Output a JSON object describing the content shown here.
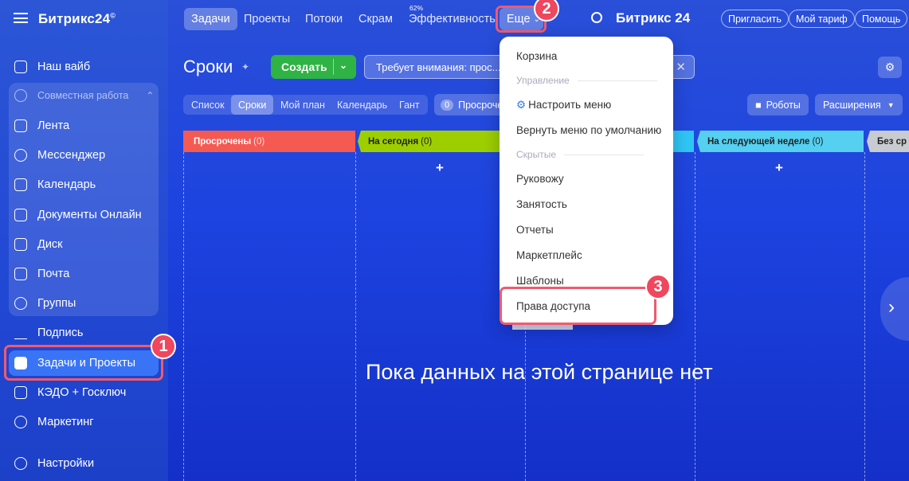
{
  "sidebar": {
    "brand": "Битрикс24",
    "brand_mark": "©",
    "items": [
      {
        "label": "Наш вайб",
        "icon": "home-icon"
      },
      {
        "label": "Совместная работа",
        "icon": "collab-icon"
      },
      {
        "label": "Лента",
        "icon": "feed-icon"
      },
      {
        "label": "Мессенджер",
        "icon": "chat-icon"
      },
      {
        "label": "Календарь",
        "icon": "calendar-icon"
      },
      {
        "label": "Документы Онлайн",
        "icon": "document-icon"
      },
      {
        "label": "Диск",
        "icon": "disk-icon"
      },
      {
        "label": "Почта",
        "icon": "mail-icon"
      },
      {
        "label": "Группы",
        "icon": "groups-icon"
      },
      {
        "label": "Подпись",
        "icon": "signature-icon"
      },
      {
        "label": "Задачи и Проекты",
        "icon": "tasks-icon"
      },
      {
        "label": "КЭДО + Госключ",
        "icon": "kedo-icon"
      },
      {
        "label": "Маркетинг",
        "icon": "marketing-icon"
      },
      {
        "label": "Настройки",
        "icon": "settings-icon"
      }
    ]
  },
  "topbar": {
    "tabs": [
      "Задачи",
      "Проекты",
      "Потоки",
      "Скрам",
      "Эффективность",
      "Еще"
    ],
    "efficiency_value": "62%",
    "brand": "Битрикс 24",
    "invite": "Пригласить",
    "tariff": "Мой тариф",
    "help": "Помощь"
  },
  "page": {
    "title": "Сроки",
    "create": "Создать",
    "filter_text": "Требует внимания: прос...",
    "views": [
      "Список",
      "Сроки",
      "Мой план",
      "Календарь",
      "Гант"
    ],
    "overdue_count": "0",
    "overdue_label": "Просроче",
    "robots": "Роботы",
    "extensions": "Расширения"
  },
  "columns": [
    {
      "title": "Просрочены",
      "count": "(0)",
      "color": "#f45a52"
    },
    {
      "title": "На сегодня",
      "count": "(0)",
      "color": "#9dcf00"
    },
    {
      "title": "На следующей неделе",
      "count": "(0)",
      "color": "#2fc6f6"
    },
    {
      "title": "Без ср",
      "count": "",
      "color": "#c8cbd0"
    }
  ],
  "empty_message": "Пока данных на этой странице нет",
  "menu": {
    "items": [
      {
        "label": "Корзина",
        "type": "item"
      },
      {
        "label": "Управление",
        "type": "header"
      },
      {
        "label": "Настроить меню",
        "type": "item",
        "icon": "gear-icon"
      },
      {
        "label": "Вернуть меню по умолчанию",
        "type": "item"
      },
      {
        "label": "Скрытые",
        "type": "header"
      },
      {
        "label": "Руковожу",
        "type": "item"
      },
      {
        "label": "Занятость",
        "type": "item"
      },
      {
        "label": "Отчеты",
        "type": "item"
      },
      {
        "label": "Маркетплейс",
        "type": "item"
      },
      {
        "label": "Шаблоны",
        "type": "item"
      },
      {
        "label": "Права доступа",
        "type": "item"
      }
    ]
  },
  "callouts": [
    "1",
    "2",
    "3"
  ],
  "colors": {
    "accent": "#2fb344",
    "callout": "#f0465e",
    "active": "#3a74f6"
  }
}
